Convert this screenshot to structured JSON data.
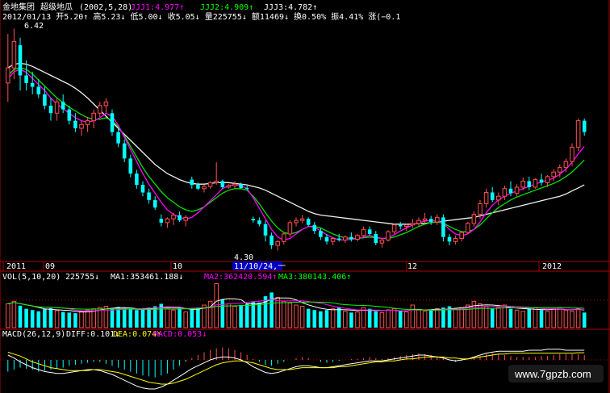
{
  "header": {
    "title": "金地集团",
    "indicator": "超级地瓜",
    "params": "(2002,5,28)",
    "jjj1": "JJJ1:4.977↑",
    "jjj2": "JJJ2:4.909↑",
    "jjj3": "JJJ3:4.782↑",
    "info_line": "2012/01/13 开5.20↑ 高5.23↓ 低5.00↓ 收5.05↓ 量225755↓ 额11469↓ 换0.50% 振4.41% 涨(−0.1"
  },
  "price_chart": {
    "high_label": "6.42",
    "low_label": "4.30",
    "x_labels": [
      "2011",
      "09",
      "10",
      "12",
      "2012"
    ],
    "cursor_date": "11/10/24,一"
  },
  "volume_panel": {
    "title": "VOL(5,10,20)",
    "vol": "225755↓",
    "ma1": "MA1:353461.188↓",
    "ma2": "MA2:362420.594↑",
    "ma3": "MA3:380143.406↑"
  },
  "macd_panel": {
    "title": "MACD(26,12,9)",
    "diff": "DIFF:0.101↓",
    "dea": "DEA:0.074↑",
    "macd": "MACD:0.053↓"
  },
  "watermark": "www.7gpzb.com",
  "colors": {
    "up": "#ff5050",
    "down": "#00ffff",
    "ma_white": "#f0f0f0",
    "ma_green": "#00e000",
    "ma_magenta": "#ff00ff",
    "axis": "#b00000",
    "label_yellow": "#ffff00"
  },
  "chart_data": {
    "type": "candlestick",
    "candles": [
      [
        5.7,
        6.35,
        5.45,
        5.9
      ],
      [
        5.9,
        6.42,
        5.75,
        6.25
      ],
      [
        6.2,
        6.3,
        5.6,
        5.8
      ],
      [
        5.8,
        6.0,
        5.6,
        5.7
      ],
      [
        5.7,
        5.85,
        5.55,
        5.65
      ],
      [
        5.65,
        5.75,
        5.5,
        5.55
      ],
      [
        5.55,
        5.65,
        5.35,
        5.4
      ],
      [
        5.4,
        5.5,
        5.2,
        5.3
      ],
      [
        5.3,
        5.5,
        5.2,
        5.45
      ],
      [
        5.45,
        5.55,
        5.3,
        5.35
      ],
      [
        5.35,
        5.4,
        5.15,
        5.2
      ],
      [
        5.2,
        5.3,
        5.05,
        5.1
      ],
      [
        5.1,
        5.2,
        5.0,
        5.15
      ],
      [
        5.15,
        5.25,
        5.05,
        5.2
      ],
      [
        5.2,
        5.35,
        5.1,
        5.3
      ],
      [
        5.3,
        5.45,
        5.25,
        5.4
      ],
      [
        5.4,
        5.5,
        5.3,
        5.45
      ],
      [
        5.3,
        5.35,
        5.0,
        5.05
      ],
      [
        5.05,
        5.1,
        4.85,
        4.9
      ],
      [
        4.9,
        4.95,
        4.65,
        4.7
      ],
      [
        4.7,
        4.75,
        4.45,
        4.5
      ],
      [
        4.5,
        4.55,
        4.3,
        4.35
      ],
      [
        4.35,
        4.4,
        4.2,
        4.25
      ],
      [
        4.25,
        4.3,
        4.1,
        4.15
      ],
      [
        4.15,
        4.2,
        4.02,
        4.05
      ],
      [
        3.9,
        3.96,
        3.8,
        3.85
      ],
      [
        3.85,
        3.92,
        3.78,
        3.9
      ],
      [
        3.9,
        3.98,
        3.82,
        3.95
      ],
      [
        3.95,
        4.0,
        3.86,
        3.88
      ],
      [
        3.88,
        3.95,
        3.8,
        3.92
      ],
      [
        4.42,
        4.46,
        4.3,
        4.35
      ],
      [
        4.35,
        4.38,
        4.28,
        4.3
      ],
      [
        4.3,
        4.35,
        4.25,
        4.33
      ],
      [
        4.33,
        4.4,
        4.3,
        4.38
      ],
      [
        4.38,
        4.65,
        4.35,
        4.4
      ],
      [
        4.4,
        4.42,
        4.3,
        4.32
      ],
      [
        4.32,
        4.36,
        4.3,
        4.34
      ],
      [
        4.34,
        4.4,
        4.3,
        4.36
      ],
      [
        4.36,
        4.38,
        4.3,
        4.31
      ],
      [
        4.31,
        4.34,
        4.28,
        4.3
      ],
      [
        3.9,
        3.93,
        3.85,
        3.88
      ],
      [
        3.88,
        3.92,
        3.8,
        3.83
      ],
      [
        3.83,
        3.88,
        3.6,
        3.68
      ],
      [
        3.68,
        3.72,
        3.5,
        3.55
      ],
      [
        3.55,
        3.62,
        3.48,
        3.6
      ],
      [
        3.6,
        3.72,
        3.56,
        3.7
      ],
      [
        3.7,
        3.88,
        3.66,
        3.85
      ],
      [
        3.85,
        3.92,
        3.8,
        3.88
      ],
      [
        3.88,
        3.95,
        3.84,
        3.9
      ],
      [
        3.9,
        3.92,
        3.8,
        3.82
      ],
      [
        3.82,
        3.86,
        3.7,
        3.74
      ],
      [
        3.74,
        3.78,
        3.62,
        3.66
      ],
      [
        3.66,
        3.7,
        3.56,
        3.6
      ],
      [
        3.6,
        3.66,
        3.55,
        3.64
      ],
      [
        3.64,
        3.7,
        3.6,
        3.62
      ],
      [
        3.62,
        3.68,
        3.58,
        3.66
      ],
      [
        3.66,
        3.72,
        3.6,
        3.63
      ],
      [
        3.63,
        3.7,
        3.6,
        3.68
      ],
      [
        3.68,
        3.8,
        3.65,
        3.76
      ],
      [
        3.76,
        3.8,
        3.68,
        3.7
      ],
      [
        3.7,
        3.74,
        3.55,
        3.58
      ],
      [
        3.58,
        3.65,
        3.52,
        3.62
      ],
      [
        3.62,
        3.75,
        3.6,
        3.73
      ],
      [
        3.73,
        3.84,
        3.7,
        3.82
      ],
      [
        3.82,
        3.86,
        3.76,
        3.8
      ],
      [
        3.8,
        3.84,
        3.74,
        3.82
      ],
      [
        3.82,
        3.9,
        3.78,
        3.84
      ],
      [
        3.84,
        3.92,
        3.8,
        3.88
      ],
      [
        3.88,
        3.98,
        3.84,
        3.9
      ],
      [
        3.9,
        3.94,
        3.82,
        3.86
      ],
      [
        3.86,
        3.96,
        3.82,
        3.92
      ],
      [
        3.92,
        3.96,
        3.6,
        3.66
      ],
      [
        3.66,
        3.7,
        3.55,
        3.6
      ],
      [
        3.6,
        3.68,
        3.56,
        3.64
      ],
      [
        3.64,
        3.74,
        3.6,
        3.72
      ],
      [
        3.72,
        3.86,
        3.7,
        3.84
      ],
      [
        3.84,
        4.0,
        3.8,
        3.96
      ],
      [
        3.96,
        4.15,
        3.9,
        4.1
      ],
      [
        4.1,
        4.3,
        4.05,
        4.25
      ],
      [
        4.25,
        4.32,
        4.12,
        4.15
      ],
      [
        4.15,
        4.25,
        4.08,
        4.2
      ],
      [
        4.2,
        4.34,
        4.15,
        4.3
      ],
      [
        4.3,
        4.4,
        4.2,
        4.24
      ],
      [
        4.24,
        4.36,
        4.2,
        4.32
      ],
      [
        4.32,
        4.45,
        4.28,
        4.4
      ],
      [
        4.4,
        4.46,
        4.28,
        4.32
      ],
      [
        4.32,
        4.44,
        4.3,
        4.42
      ],
      [
        4.42,
        4.5,
        4.34,
        4.38
      ],
      [
        4.38,
        4.48,
        4.32,
        4.46
      ],
      [
        4.46,
        4.56,
        4.4,
        4.52
      ],
      [
        4.52,
        4.62,
        4.45,
        4.58
      ],
      [
        4.58,
        4.7,
        4.52,
        4.66
      ],
      [
        4.66,
        4.9,
        4.6,
        4.85
      ],
      [
        4.85,
        5.23,
        4.8,
        5.2
      ],
      [
        5.2,
        5.23,
        5.0,
        5.05
      ]
    ],
    "ma_white": [
      5.9,
      5.95,
      5.96,
      5.95,
      5.92,
      5.88,
      5.84,
      5.8,
      5.76,
      5.72,
      5.68,
      5.63,
      5.57,
      5.5,
      5.42,
      5.34,
      5.26,
      5.18,
      5.1,
      5.02,
      4.94,
      4.86,
      4.78,
      4.7,
      4.62,
      4.56,
      4.5,
      4.46,
      4.42,
      4.39,
      4.37,
      4.36,
      4.36,
      4.37,
      4.38,
      4.38,
      4.38,
      4.37,
      4.36,
      4.35,
      4.33,
      4.31,
      4.28,
      4.24,
      4.2,
      4.16,
      4.12,
      4.08,
      4.04,
      4.0,
      3.97,
      3.95,
      3.94,
      3.93,
      3.92,
      3.91,
      3.9,
      3.89,
      3.88,
      3.87,
      3.86,
      3.85,
      3.84,
      3.83,
      3.83,
      3.83,
      3.83,
      3.84,
      3.84,
      3.85,
      3.86,
      3.87,
      3.88,
      3.89,
      3.9,
      3.91,
      3.92,
      3.94,
      3.96,
      3.98,
      4.0,
      4.02,
      4.04,
      4.06,
      4.08,
      4.1,
      4.12,
      4.14,
      4.16,
      4.18,
      4.2,
      4.23,
      4.27,
      4.31,
      4.35
    ],
    "ma_green": [
      5.8,
      5.88,
      5.9,
      5.88,
      5.82,
      5.74,
      5.66,
      5.58,
      5.5,
      5.44,
      5.38,
      5.33,
      5.28,
      5.24,
      5.22,
      5.22,
      5.24,
      5.2,
      5.12,
      5.0,
      4.86,
      4.72,
      4.58,
      4.46,
      4.36,
      4.26,
      4.18,
      4.12,
      4.06,
      4.02,
      4.0,
      4.02,
      4.06,
      4.12,
      4.18,
      4.24,
      4.28,
      4.3,
      4.3,
      4.28,
      4.2,
      4.1,
      3.98,
      3.87,
      3.78,
      3.72,
      3.7,
      3.72,
      3.76,
      3.8,
      3.8,
      3.78,
      3.74,
      3.7,
      3.67,
      3.65,
      3.64,
      3.64,
      3.65,
      3.66,
      3.65,
      3.64,
      3.64,
      3.66,
      3.69,
      3.72,
      3.76,
      3.8,
      3.83,
      3.85,
      3.86,
      3.84,
      3.8,
      3.76,
      3.73,
      3.73,
      3.76,
      3.82,
      3.9,
      3.98,
      4.05,
      4.1,
      4.15,
      4.19,
      4.22,
      4.25,
      4.28,
      4.31,
      4.34,
      4.37,
      4.41,
      4.46,
      4.52,
      4.6,
      4.68
    ],
    "ma_magenta": [
      5.75,
      5.85,
      5.88,
      5.84,
      5.76,
      5.68,
      5.6,
      5.5,
      5.42,
      5.36,
      5.3,
      5.24,
      5.2,
      5.18,
      5.2,
      5.24,
      5.3,
      5.26,
      5.14,
      4.98,
      4.82,
      4.66,
      4.5,
      4.36,
      4.24,
      4.12,
      4.02,
      3.96,
      3.92,
      3.9,
      3.92,
      3.98,
      4.06,
      4.14,
      4.22,
      4.3,
      4.34,
      4.35,
      4.34,
      4.3,
      4.18,
      4.04,
      3.9,
      3.76,
      3.66,
      3.62,
      3.64,
      3.7,
      3.76,
      3.8,
      3.79,
      3.74,
      3.69,
      3.65,
      3.62,
      3.62,
      3.63,
      3.64,
      3.66,
      3.68,
      3.66,
      3.64,
      3.65,
      3.69,
      3.74,
      3.78,
      3.82,
      3.85,
      3.87,
      3.88,
      3.88,
      3.84,
      3.76,
      3.7,
      3.68,
      3.7,
      3.76,
      3.86,
      3.98,
      4.08,
      4.15,
      4.2,
      4.24,
      4.27,
      4.3,
      4.33,
      4.36,
      4.39,
      4.41,
      4.44,
      4.49,
      4.56,
      4.65,
      4.76,
      4.86
    ],
    "volume": [
      380,
      420,
      350,
      300,
      280,
      260,
      300,
      310,
      270,
      250,
      240,
      230,
      260,
      280,
      300,
      320,
      340,
      300,
      330,
      310,
      290,
      280,
      300,
      320,
      340,
      380,
      300,
      280,
      320,
      250,
      300,
      320,
      360,
      420,
      700,
      450,
      380,
      340,
      360,
      380,
      420,
      400,
      500,
      560,
      480,
      420,
      390,
      360,
      340,
      300,
      280,
      260,
      280,
      300,
      320,
      260,
      240,
      250,
      320,
      300,
      260,
      240,
      280,
      300,
      260,
      250,
      360,
      280,
      260,
      280,
      300,
      320,
      340,
      300,
      320,
      360,
      420,
      380,
      340,
      300,
      320,
      360,
      300,
      280,
      260,
      300,
      320,
      280,
      260,
      300,
      320,
      280,
      260,
      300,
      240
    ],
    "macd_hist": [
      -0.12,
      -0.1,
      -0.08,
      -0.09,
      -0.1,
      -0.12,
      -0.11,
      -0.1,
      -0.09,
      -0.08,
      -0.06,
      -0.05,
      -0.04,
      -0.03,
      -0.02,
      -0.02,
      -0.04,
      -0.06,
      -0.08,
      -0.1,
      -0.12,
      -0.14,
      -0.16,
      -0.17,
      -0.18,
      -0.16,
      -0.14,
      -0.1,
      -0.06,
      -0.02,
      0.02,
      0.05,
      0.08,
      0.1,
      0.12,
      0.13,
      0.12,
      0.1,
      0.08,
      0.05,
      0.01,
      -0.02,
      -0.05,
      -0.06,
      -0.04,
      -0.02,
      0.0,
      0.02,
      0.03,
      0.02,
      0.0,
      -0.02,
      -0.03,
      -0.02,
      -0.01,
      0.0,
      0.01,
      0.01,
      0.02,
      0.03,
      0.02,
      0.01,
      0.02,
      0.03,
      0.04,
      0.05,
      0.06,
      0.07,
      0.06,
      0.05,
      0.04,
      0.02,
      0.0,
      -0.02,
      -0.01,
      0.0,
      0.02,
      0.04,
      0.06,
      0.07,
      0.06,
      0.05,
      0.04,
      0.03,
      0.03,
      0.03,
      0.03,
      0.04,
      0.04,
      0.05,
      0.06,
      0.06,
      0.06,
      0.06,
      0.05
    ],
    "diff": [
      0.05,
      0.02,
      -0.02,
      -0.05,
      -0.08,
      -0.1,
      -0.12,
      -0.13,
      -0.14,
      -0.14,
      -0.13,
      -0.12,
      -0.11,
      -0.1,
      -0.1,
      -0.11,
      -0.13,
      -0.15,
      -0.18,
      -0.21,
      -0.24,
      -0.27,
      -0.29,
      -0.3,
      -0.3,
      -0.28,
      -0.25,
      -0.21,
      -0.17,
      -0.13,
      -0.09,
      -0.06,
      -0.03,
      0.0,
      0.02,
      0.03,
      0.03,
      0.02,
      0.0,
      -0.03,
      -0.07,
      -0.1,
      -0.13,
      -0.14,
      -0.13,
      -0.11,
      -0.09,
      -0.07,
      -0.06,
      -0.06,
      -0.07,
      -0.08,
      -0.08,
      -0.07,
      -0.06,
      -0.05,
      -0.04,
      -0.03,
      -0.02,
      -0.01,
      -0.01,
      -0.01,
      0.0,
      0.01,
      0.02,
      0.03,
      0.04,
      0.05,
      0.05,
      0.04,
      0.03,
      0.02,
      0.0,
      -0.01,
      0.0,
      0.01,
      0.03,
      0.05,
      0.07,
      0.08,
      0.09,
      0.09,
      0.09,
      0.09,
      0.09,
      0.1,
      0.1,
      0.1,
      0.11,
      0.11,
      0.11,
      0.1,
      0.1,
      0.1,
      0.1
    ],
    "dea": [
      0.08,
      0.06,
      0.04,
      0.01,
      -0.02,
      -0.04,
      -0.06,
      -0.08,
      -0.09,
      -0.1,
      -0.11,
      -0.11,
      -0.11,
      -0.11,
      -0.1,
      -0.1,
      -0.11,
      -0.12,
      -0.13,
      -0.15,
      -0.17,
      -0.19,
      -0.21,
      -0.23,
      -0.24,
      -0.25,
      -0.25,
      -0.24,
      -0.22,
      -0.2,
      -0.17,
      -0.14,
      -0.11,
      -0.08,
      -0.05,
      -0.03,
      -0.02,
      -0.01,
      -0.01,
      -0.02,
      -0.03,
      -0.05,
      -0.07,
      -0.09,
      -0.1,
      -0.1,
      -0.1,
      -0.09,
      -0.08,
      -0.08,
      -0.08,
      -0.08,
      -0.08,
      -0.08,
      -0.07,
      -0.07,
      -0.06,
      -0.05,
      -0.04,
      -0.03,
      -0.02,
      -0.02,
      -0.01,
      -0.01,
      0.0,
      0.01,
      0.01,
      0.02,
      0.03,
      0.03,
      0.03,
      0.03,
      0.02,
      0.02,
      0.01,
      0.01,
      0.02,
      0.03,
      0.04,
      0.05,
      0.06,
      0.06,
      0.07,
      0.07,
      0.07,
      0.07,
      0.07,
      0.07,
      0.07,
      0.07,
      0.07,
      0.07,
      0.07,
      0.074,
      0.074
    ]
  }
}
